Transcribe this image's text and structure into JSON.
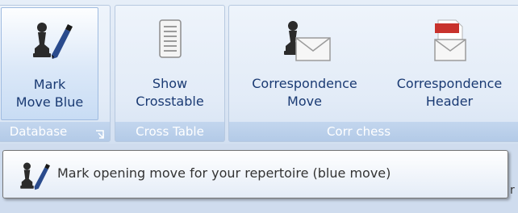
{
  "ribbon": {
    "groups": [
      {
        "footer": "Database",
        "buttons": [
          {
            "label_line1": "Mark",
            "label_line2": "Move Blue",
            "icon": "pawn-pen-icon"
          }
        ]
      },
      {
        "footer": "Cross Table",
        "buttons": [
          {
            "label_line1": "Show",
            "label_line2": "Crosstable",
            "icon": "crosstable-icon"
          }
        ]
      },
      {
        "footer": "Corr chess",
        "buttons": [
          {
            "label_line1": "Correspondence",
            "label_line2": "Move",
            "icon": "pawn-envelope-icon"
          },
          {
            "label_line1": "Correspondence",
            "label_line2": "Header",
            "icon": "xml-envelope-icon"
          }
        ]
      }
    ]
  },
  "tooltip": {
    "text": "Mark opening move for your repertoire (blue move)",
    "icon": "pawn-pen-icon"
  },
  "colors": {
    "label": "#1a3a73",
    "group_footer": "#b3cae7",
    "xml_badge": "#c8322c"
  }
}
